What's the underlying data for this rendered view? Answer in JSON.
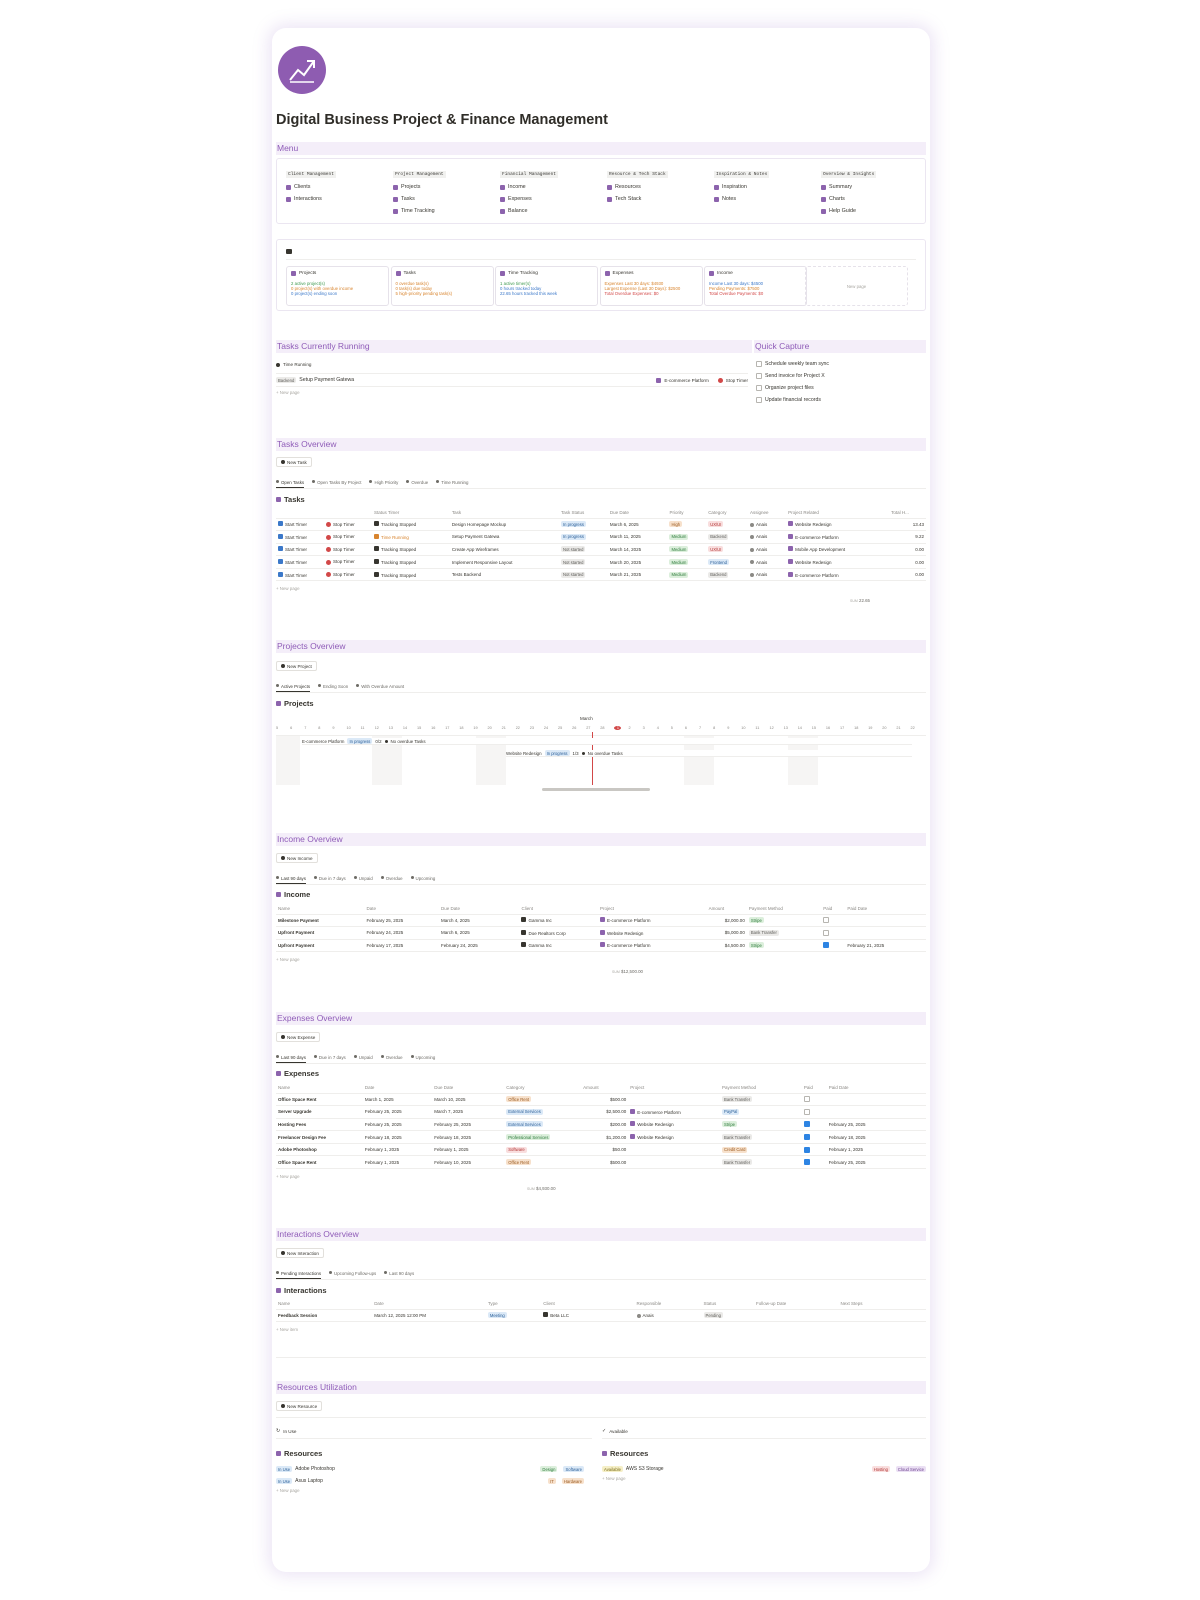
{
  "page": {
    "title": "Digital Business Project & Finance Management"
  },
  "menu": {
    "heading": "Menu",
    "columns": [
      {
        "head": "Client Management",
        "items": [
          "Clients",
          "Interactions"
        ]
      },
      {
        "head": "Project Management",
        "items": [
          "Projects",
          "Tasks",
          "Time Tracking"
        ]
      },
      {
        "head": "Financial Management",
        "items": [
          "Income",
          "Expenses",
          "Balance"
        ]
      },
      {
        "head": "Resource & Tech Stack",
        "items": [
          "Resources",
          "Tech Stack"
        ]
      },
      {
        "head": "Inspiration & Notes",
        "items": [
          "Inspiration",
          "Notes"
        ]
      },
      {
        "head": "Overview & Insights",
        "items": [
          "Summary",
          "Charts",
          "Help Guide"
        ]
      }
    ]
  },
  "summary": {
    "cards": [
      {
        "title": "Projects",
        "lines": [
          "2 active project(s)",
          "0 project(s) with overdue income",
          "0 project(s) ending soon"
        ]
      },
      {
        "title": "Tasks",
        "lines": [
          "0 overdue task(s)",
          "0 task(s) due today",
          "5 high-priority pending task(s)"
        ]
      },
      {
        "title": "Time Tracking",
        "lines": [
          "1 active timer(s)",
          "0 hours tracked today",
          "22.65 hours tracked this week"
        ]
      },
      {
        "title": "Expenses",
        "lines": [
          "Expenses Last 30 days: $4930",
          "Largest Expense (Last 30 Days): $2500",
          "Total Overdue Expenses: $0"
        ]
      },
      {
        "title": "Income",
        "lines": [
          "Income Last 30 days: $4500",
          "Pending Payments: $7500",
          "Total Overdue Payments: $0"
        ]
      }
    ],
    "new_page": "New page"
  },
  "running": {
    "heading": "Tasks Currently Running",
    "view": "Time Running",
    "tag": "Backend",
    "task": "Setup Payment Gatewa",
    "project": "E-commerce Platform",
    "stop": "Stop Timer",
    "new": "New page"
  },
  "quick": {
    "heading": "Quick Capture",
    "items": [
      "Schedule weekly team sync",
      "Send invoice for Project X",
      "Organize project files",
      "Update financial records"
    ]
  },
  "tasks": {
    "heading": "Tasks Overview",
    "new_btn": "New Task",
    "tabs": [
      "Open Tasks",
      "Open Tasks By Project",
      "High Priority",
      "Overdue",
      "Time Running"
    ],
    "db": "Tasks",
    "cols": [
      "Status Timer",
      "Task",
      "Task Status",
      "Due Date",
      "Priority",
      "Category",
      "Assignee",
      "Project Related",
      "Total H..."
    ],
    "rows": [
      [
        "Start Timer",
        "Stop Timer",
        "Tracking Stopped",
        "Design Homepage Mockup",
        "In progress",
        "March 6, 2025",
        "High",
        "UX/UI",
        "Anais",
        "Website Redesign",
        "13.43"
      ],
      [
        "Start Timer",
        "Stop Timer",
        "Time Running",
        "Setup Payment Gatewa",
        "In progress",
        "March 11, 2025",
        "Medium",
        "Backend",
        "Anais",
        "E-commerce Platform",
        "9.22"
      ],
      [
        "Start Timer",
        "Stop Timer",
        "Tracking Stopped",
        "Create App Wireframes",
        "Not started",
        "March 14, 2025",
        "Medium",
        "UX/UI",
        "Anais",
        "Mobile App Development",
        "0.00"
      ],
      [
        "Start Timer",
        "Stop Timer",
        "Tracking Stopped",
        "Implement Responsive Layout",
        "Not started",
        "March 20, 2025",
        "Medium",
        "Frontend",
        "Anais",
        "Website Redesign",
        "0.00"
      ],
      [
        "Start Timer",
        "Stop Timer",
        "Tracking Stopped",
        "Tests Backend",
        "Not started",
        "March 21, 2025",
        "Medium",
        "Backend",
        "Anais",
        "E-commerce Platform",
        "0.00"
      ]
    ],
    "sum_label": "SUM",
    "sum": "22.65",
    "new": "New page"
  },
  "projects": {
    "heading": "Projects Overview",
    "new_btn": "New Project",
    "tabs": [
      "Active Projects",
      "Ending Soon",
      "With Overdue Amount"
    ],
    "db": "Projects",
    "month": "March",
    "days": [
      "5",
      "6",
      "7",
      "8",
      "9",
      "10",
      "11",
      "12",
      "13",
      "14",
      "15",
      "16",
      "17",
      "18",
      "19",
      "20",
      "21",
      "22",
      "23",
      "24",
      "25",
      "26",
      "27",
      "28",
      "1",
      "2",
      "3",
      "4",
      "5",
      "6",
      "7",
      "8",
      "9",
      "10",
      "11",
      "12",
      "13",
      "14",
      "15",
      "16",
      "17",
      "18",
      "19",
      "20",
      "21",
      "22"
    ],
    "bars": [
      {
        "name": "E-commerce Platform",
        "status": "In progress",
        "count": "0/2",
        "note": "No overdue Tasks"
      },
      {
        "name": "Website Redesign",
        "status": "In progress",
        "count": "1/3",
        "note": "No overdue Tasks"
      }
    ]
  },
  "income": {
    "heading": "Income Overview",
    "new_btn": "New Income",
    "tabs": [
      "Last 90 days",
      "Due in 7 days",
      "Unpaid",
      "Overdue",
      "Upcoming"
    ],
    "db": "Income",
    "cols": [
      "Name",
      "Date",
      "Due Date",
      "Client",
      "Project",
      "Amount",
      "Payment Method",
      "Paid",
      "Paid Date"
    ],
    "rows": [
      [
        "Milestone Payment",
        "February 25, 2025",
        "March 4, 2025",
        "Gamma Inc",
        "E-commerce Platform",
        "$2,000.00",
        "Stripe",
        false,
        ""
      ],
      [
        "Upfront Payment",
        "February 24, 2025",
        "March 6, 2025",
        "Doe Realtors Corp",
        "Website Redesign",
        "$5,000.00",
        "Bank Transfer",
        false,
        ""
      ],
      [
        "Upfront Payment",
        "February 17, 2025",
        "February 24, 2025",
        "Gamma Inc",
        "E-commerce Platform",
        "$4,500.00",
        "Stripe",
        true,
        "February 21, 2025"
      ]
    ],
    "sum_label": "SUM",
    "sum": "$12,500.00",
    "new": "New page"
  },
  "expenses": {
    "heading": "Expenses Overview",
    "new_btn": "New Expense",
    "tabs": [
      "Last 90 days",
      "Due in 7 days",
      "Unpaid",
      "Overdue",
      "Upcoming"
    ],
    "db": "Expenses",
    "cols": [
      "Name",
      "Date",
      "Due Date",
      "Category",
      "Amount",
      "Project",
      "Payment Method",
      "Paid",
      "Paid Date"
    ],
    "rows": [
      [
        "Office Space Rent",
        "March 1, 2025",
        "March 10, 2025",
        "Office Rent",
        "$500.00",
        "",
        "Bank Transfer",
        false,
        ""
      ],
      [
        "Server Upgrade",
        "February 25, 2025",
        "March 7, 2025",
        "External Services",
        "$2,500.00",
        "E-commerce Platform",
        "PayPal",
        false,
        ""
      ],
      [
        "Hosting Fees",
        "February 25, 2025",
        "February 25, 2025",
        "External Services",
        "$200.00",
        "Website Redesign",
        "Stripe",
        true,
        "February 25, 2025"
      ],
      [
        "Freelancer Design Fee",
        "February 18, 2025",
        "February 18, 2025",
        "Professional Services",
        "$1,200.00",
        "Website Redesign",
        "Bank Transfer",
        true,
        "February 18, 2025"
      ],
      [
        "Adobe Photoshop",
        "February 1, 2025",
        "February 1, 2025",
        "Software",
        "$50.00",
        "",
        "Credit Card",
        true,
        "February 1, 2025"
      ],
      [
        "Office Space Rent",
        "February 1, 2025",
        "February 10, 2025",
        "Office Rent",
        "$500.00",
        "",
        "Bank Transfer",
        true,
        "February 25, 2025"
      ]
    ],
    "sum_label": "SUM",
    "sum": "$4,930.00",
    "new": "New page"
  },
  "interactions": {
    "heading": "Interactions Overview",
    "new_btn": "New Interaction",
    "tabs": [
      "Pending Interactions",
      "Upcoming Follow-ups",
      "Last 90 days"
    ],
    "db": "Interactions",
    "cols": [
      "Name",
      "Date",
      "Type",
      "Client",
      "Responsible",
      "Status",
      "Follow-up Date",
      "Next Steps"
    ],
    "rows": [
      [
        "Feedback Session",
        "March 12, 2025 12:00 PM",
        "Meeting",
        "Beta LLC",
        "Anais",
        "Pending",
        "",
        ""
      ]
    ],
    "new": "New item"
  },
  "resources": {
    "heading": "Resources Utilization",
    "new_btn": "New Resource",
    "left_view": "In Use",
    "right_view": "Available",
    "db": "Resources",
    "left": [
      {
        "status": "In Use",
        "name": "Adobe Photoshop",
        "tags": [
          "Design",
          "Software"
        ]
      },
      {
        "status": "In Use",
        "name": "Asus Laptop",
        "tags": [
          "IT",
          "Hardware"
        ]
      }
    ],
    "right": [
      {
        "status": "Available",
        "name": "AWS S3 Storage",
        "tags": [
          "Hosting",
          "Cloud Service"
        ]
      }
    ],
    "new": "New page"
  }
}
